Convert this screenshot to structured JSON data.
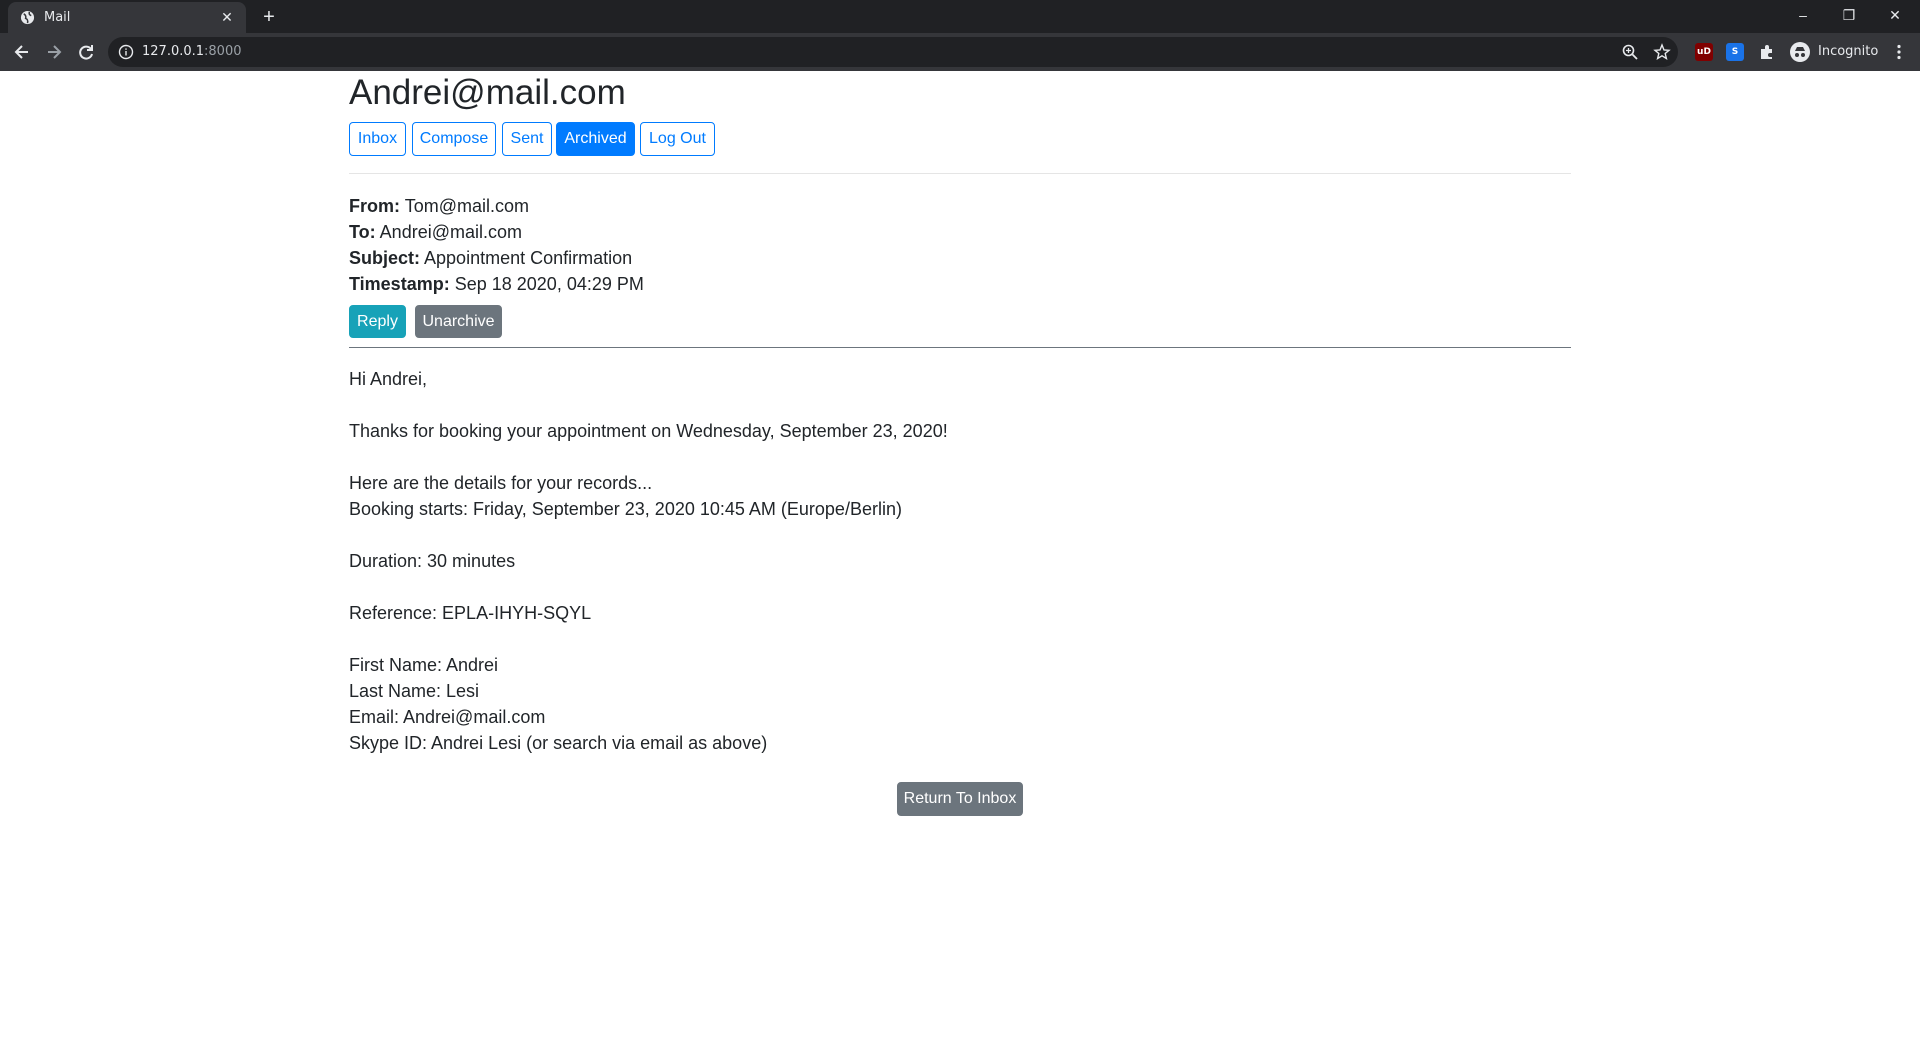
{
  "browser": {
    "tab_title": "Mail",
    "url_host": "127.0.0.1",
    "url_port": ":8000",
    "profile_label": "Incognito",
    "extensions": [
      "uBlock",
      "S"
    ]
  },
  "mail": {
    "user": "Andrei@mail.com",
    "nav": {
      "inbox": "Inbox",
      "compose": "Compose",
      "sent": "Sent",
      "archived": "Archived",
      "logout": "Log Out"
    },
    "active_nav": "archived",
    "email": {
      "from_label": "From:",
      "from": "Tom@mail.com",
      "to_label": "To:",
      "to": "Andrei@mail.com",
      "subject_label": "Subject:",
      "subject": "Appointment Confirmation",
      "timestamp_label": "Timestamp:",
      "timestamp": "Sep 18 2020, 04:29 PM",
      "body": {
        "greeting": "Hi Andrei,",
        "thanks": "Thanks for booking your appointment on Wednesday, September 23, 2020!",
        "details_intro": "Here are the details for your records...",
        "booking_starts": "Booking starts: Friday, September 23, 2020 10:45 AM (Europe/Berlin)",
        "duration": "Duration: 30 minutes",
        "reference": "Reference: EPLA-IHYH-SQYL",
        "first_name": "First Name: Andrei",
        "last_name": "Last Name: Lesi",
        "email": "Email: Andrei@mail.com",
        "skype": "Skype ID: Andrei Lesi (or search via email as above)"
      }
    },
    "actions": {
      "reply": "Reply",
      "unarchive": "Unarchive",
      "return_to_inbox": "Return To Inbox"
    }
  },
  "colors": {
    "primary": "#007bff",
    "info": "#17a2b8",
    "secondary": "#6c757d",
    "chrome_dark": "#202124",
    "chrome_toolbar": "#35363a"
  }
}
